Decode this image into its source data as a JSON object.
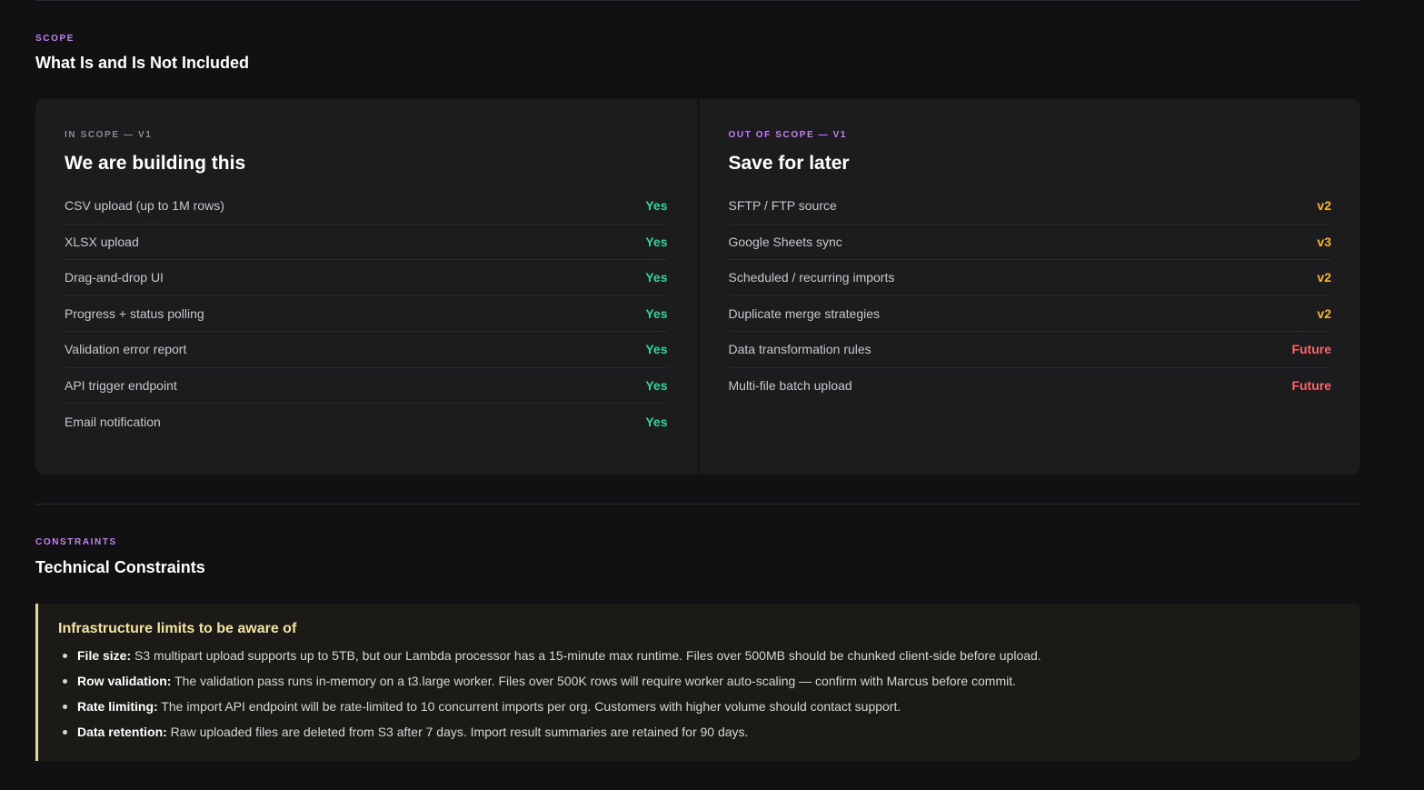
{
  "scope": {
    "eyebrow": "SCOPE",
    "title": "What Is and Is Not Included",
    "in_scope": {
      "eyebrow": "IN SCOPE — V1",
      "title": "We are building this",
      "items": [
        {
          "label": "CSV upload (up to 1M rows)",
          "value": "Yes",
          "status": "yes"
        },
        {
          "label": "XLSX upload",
          "value": "Yes",
          "status": "yes"
        },
        {
          "label": "Drag-and-drop UI",
          "value": "Yes",
          "status": "yes"
        },
        {
          "label": "Progress + status polling",
          "value": "Yes",
          "status": "yes"
        },
        {
          "label": "Validation error report",
          "value": "Yes",
          "status": "yes"
        },
        {
          "label": "API trigger endpoint",
          "value": "Yes",
          "status": "yes"
        },
        {
          "label": "Email notification",
          "value": "Yes",
          "status": "yes"
        }
      ]
    },
    "out_scope": {
      "eyebrow": "OUT OF SCOPE — V1",
      "title": "Save for later",
      "items": [
        {
          "label": "SFTP / FTP source",
          "value": "v2",
          "status": "v2"
        },
        {
          "label": "Google Sheets sync",
          "value": "v3",
          "status": "v2"
        },
        {
          "label": "Scheduled / recurring imports",
          "value": "v2",
          "status": "v2"
        },
        {
          "label": "Duplicate merge strategies",
          "value": "v2",
          "status": "v2"
        },
        {
          "label": "Data transformation rules",
          "value": "Future",
          "status": "future"
        },
        {
          "label": "Multi-file batch upload",
          "value": "Future",
          "status": "future"
        }
      ]
    }
  },
  "constraints": {
    "eyebrow": "CONSTRAINTS",
    "title": "Technical Constraints",
    "box_title": "Infrastructure limits to be aware of",
    "items": [
      {
        "term": "File size:",
        "text": " S3 multipart upload supports up to 5TB, but our Lambda processor has a 15-minute max runtime. Files over 500MB should be chunked client-side before upload."
      },
      {
        "term": "Row validation:",
        "text": " The validation pass runs in-memory on a t3.large worker. Files over 500K rows will require worker auto-scaling — confirm with Marcus before commit."
      },
      {
        "term": "Rate limiting:",
        "text": " The import API endpoint will be rate-limited to 10 concurrent imports per org. Customers with higher volume should contact support."
      },
      {
        "term": "Data retention:",
        "text": " Raw uploaded files are deleted from S3 after 7 days. Import result summaries are retained for 90 days."
      }
    ]
  },
  "colors": {
    "accent": "#c084e8",
    "yes": "#34d399",
    "version": "#f5b82e",
    "future": "#f26a6a",
    "callout_border": "#e8d98a"
  }
}
